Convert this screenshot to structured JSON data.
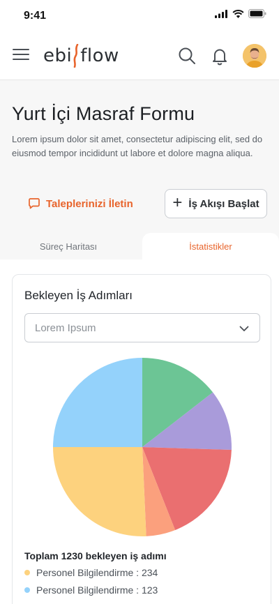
{
  "status_bar": {
    "time": "9:41"
  },
  "header": {
    "logo_text_left": "ebi",
    "logo_text_right": "flow"
  },
  "page": {
    "title": "Yurt İçi Masraf Formu",
    "description": "Lorem ipsum dolor sit amet, consectetur adipiscing elit, sed do eiusmod tempor incididunt ut labore et dolore magna aliqua."
  },
  "actions": {
    "requests_label": "Taleplerinizi İletin",
    "start_workflow_label": "İş Akışı Başlat",
    "start_workflow_icon": "+"
  },
  "tabs": [
    {
      "label": "Süreç Haritası",
      "active": false
    },
    {
      "label": "İstatistikler",
      "active": true
    }
  ],
  "card": {
    "title": "Bekleyen İş Adımları",
    "select_placeholder": "Lorem Ipsum",
    "total_text": "Toplam 1230 bekleyen iş adımı",
    "legend": [
      {
        "label": "Personel Bilgilendirme : 234",
        "color": "#fdd27e"
      },
      {
        "label": "Personel Bilgilendirme : 123",
        "color": "#94d2fb"
      }
    ]
  },
  "chart_data": {
    "type": "pie",
    "slices": [
      {
        "value": 14.5,
        "color": "#6cc595"
      },
      {
        "value": 11.0,
        "color": "#a99bda"
      },
      {
        "value": 18.5,
        "color": "#ea6f70"
      },
      {
        "value": 5.3,
        "color": "#fba07d"
      },
      {
        "value": 25.7,
        "color": "#fdd27e"
      },
      {
        "value": 25.0,
        "color": "#94d2fb"
      }
    ]
  },
  "colors": {
    "accent": "#e8642c"
  }
}
